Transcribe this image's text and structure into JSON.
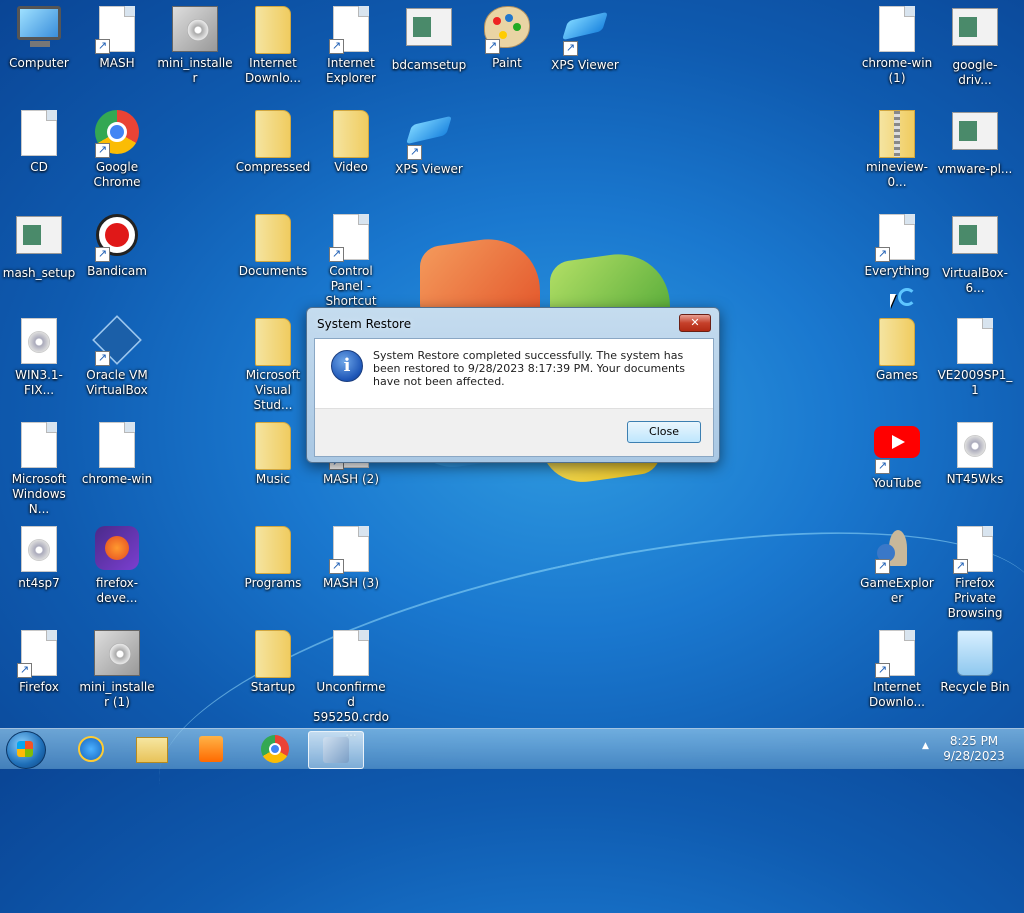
{
  "desktop": {
    "icons": [
      {
        "id": "computer",
        "label": "Computer",
        "type": "computer",
        "shortcut": false
      },
      {
        "id": "mash",
        "label": "MASH",
        "type": "doc",
        "shortcut": true
      },
      {
        "id": "mini_installer",
        "label": "mini_installer",
        "type": "installer",
        "shortcut": false
      },
      {
        "id": "internet_downlo1",
        "label": "Internet Downlo...",
        "type": "folder",
        "shortcut": false
      },
      {
        "id": "internet_explorer",
        "label": "Internet Explorer",
        "type": "doc",
        "shortcut": true
      },
      {
        "id": "bdcamsetup",
        "label": "bdcamsetup",
        "type": "app",
        "shortcut": false
      },
      {
        "id": "paint",
        "label": "Paint",
        "type": "paint",
        "shortcut": true
      },
      {
        "id": "xps_viewer1",
        "label": "XPS Viewer",
        "type": "xps",
        "shortcut": true
      },
      {
        "id": "chrome_win1",
        "label": "chrome-win (1)",
        "type": "doc",
        "shortcut": false
      },
      {
        "id": "google_drive",
        "label": "google-driv...",
        "type": "app",
        "shortcut": false
      },
      {
        "id": "cd",
        "label": "CD",
        "type": "doc",
        "shortcut": false
      },
      {
        "id": "google_chrome",
        "label": "Google Chrome",
        "type": "chrome",
        "shortcut": true
      },
      {
        "id": "compressed",
        "label": "Compressed",
        "type": "folder",
        "shortcut": false
      },
      {
        "id": "video",
        "label": "Video",
        "type": "folder",
        "shortcut": false
      },
      {
        "id": "xps_viewer2",
        "label": "XPS Viewer",
        "type": "xps",
        "shortcut": true
      },
      {
        "id": "mineview",
        "label": "mineview-0...",
        "type": "zip",
        "shortcut": false
      },
      {
        "id": "vmware",
        "label": "vmware-pl...",
        "type": "app",
        "shortcut": false
      },
      {
        "id": "mash_setup",
        "label": "mash_setup",
        "type": "app",
        "shortcut": false
      },
      {
        "id": "bandicam",
        "label": "Bandicam",
        "type": "bandicam",
        "shortcut": true
      },
      {
        "id": "documents",
        "label": "Documents",
        "type": "folder",
        "shortcut": false
      },
      {
        "id": "control_panel",
        "label": "Control Panel - Shortcut",
        "type": "doc",
        "shortcut": true
      },
      {
        "id": "everything",
        "label": "Everything",
        "type": "doc",
        "shortcut": true
      },
      {
        "id": "virtualbox6",
        "label": "VirtualBox-6...",
        "type": "app",
        "shortcut": false
      },
      {
        "id": "win31fix",
        "label": "WIN3.1-FIX...",
        "type": "disc",
        "shortcut": false
      },
      {
        "id": "oracle_vm",
        "label": "Oracle VM VirtualBox",
        "type": "vbox",
        "shortcut": true
      },
      {
        "id": "ms_visual_studio",
        "label": "Microsoft Visual Stud...",
        "type": "folder",
        "shortcut": false
      },
      {
        "id": "games",
        "label": "Games",
        "type": "folder",
        "shortcut": false
      },
      {
        "id": "ve2009sp1",
        "label": "VE2009SP1_1",
        "type": "doc",
        "shortcut": false
      },
      {
        "id": "ms_windows_n",
        "label": "Microsoft Windows N...",
        "type": "doc",
        "shortcut": false
      },
      {
        "id": "chrome_win",
        "label": "chrome-win",
        "type": "doc",
        "shortcut": false
      },
      {
        "id": "music",
        "label": "Music",
        "type": "folder",
        "shortcut": false
      },
      {
        "id": "mash2",
        "label": "MASH (2)",
        "type": "doc",
        "shortcut": true
      },
      {
        "id": "youtube",
        "label": "YouTube",
        "type": "youtube",
        "shortcut": true
      },
      {
        "id": "nt45wks",
        "label": "NT45Wks",
        "type": "disc",
        "shortcut": false
      },
      {
        "id": "nt4sp7",
        "label": "nt4sp7",
        "type": "disc",
        "shortcut": false
      },
      {
        "id": "firefox_dev",
        "label": "firefox-deve...",
        "type": "firefoxdev",
        "shortcut": false
      },
      {
        "id": "programs",
        "label": "Programs",
        "type": "folder",
        "shortcut": false
      },
      {
        "id": "mash3",
        "label": "MASH (3)",
        "type": "doc",
        "shortcut": true
      },
      {
        "id": "gameexplorer",
        "label": "GameExplorer",
        "type": "game",
        "shortcut": true
      },
      {
        "id": "firefox_private",
        "label": "Firefox Private Browsing",
        "type": "doc",
        "shortcut": true
      },
      {
        "id": "firefox",
        "label": "Firefox",
        "type": "doc",
        "shortcut": true
      },
      {
        "id": "mini_installer1",
        "label": "mini_installer (1)",
        "type": "installer",
        "shortcut": false
      },
      {
        "id": "startup",
        "label": "Startup",
        "type": "folder",
        "shortcut": false
      },
      {
        "id": "unconfirmed",
        "label": "Unconfirmed 595250.crdo...",
        "type": "doc",
        "shortcut": false
      },
      {
        "id": "internet_downlo2",
        "label": "Internet Downlo...",
        "type": "doc",
        "shortcut": true
      },
      {
        "id": "recycle_bin",
        "label": "Recycle Bin",
        "type": "recycle",
        "shortcut": false
      }
    ]
  },
  "dialog": {
    "title": "System Restore",
    "close_x": "✕",
    "icon": "info-icon",
    "message": "System Restore completed successfully. The system has been restored to 9/28/2023 8:17:39 PM. Your documents have not been affected.",
    "button_label": "Close"
  },
  "taskbar": {
    "apps": [
      "internet-explorer",
      "windows-explorer",
      "media-player",
      "google-chrome",
      "system-restore"
    ],
    "clock_time": "8:25 PM",
    "clock_date": "9/28/2023",
    "tray_arrow": "▲"
  }
}
